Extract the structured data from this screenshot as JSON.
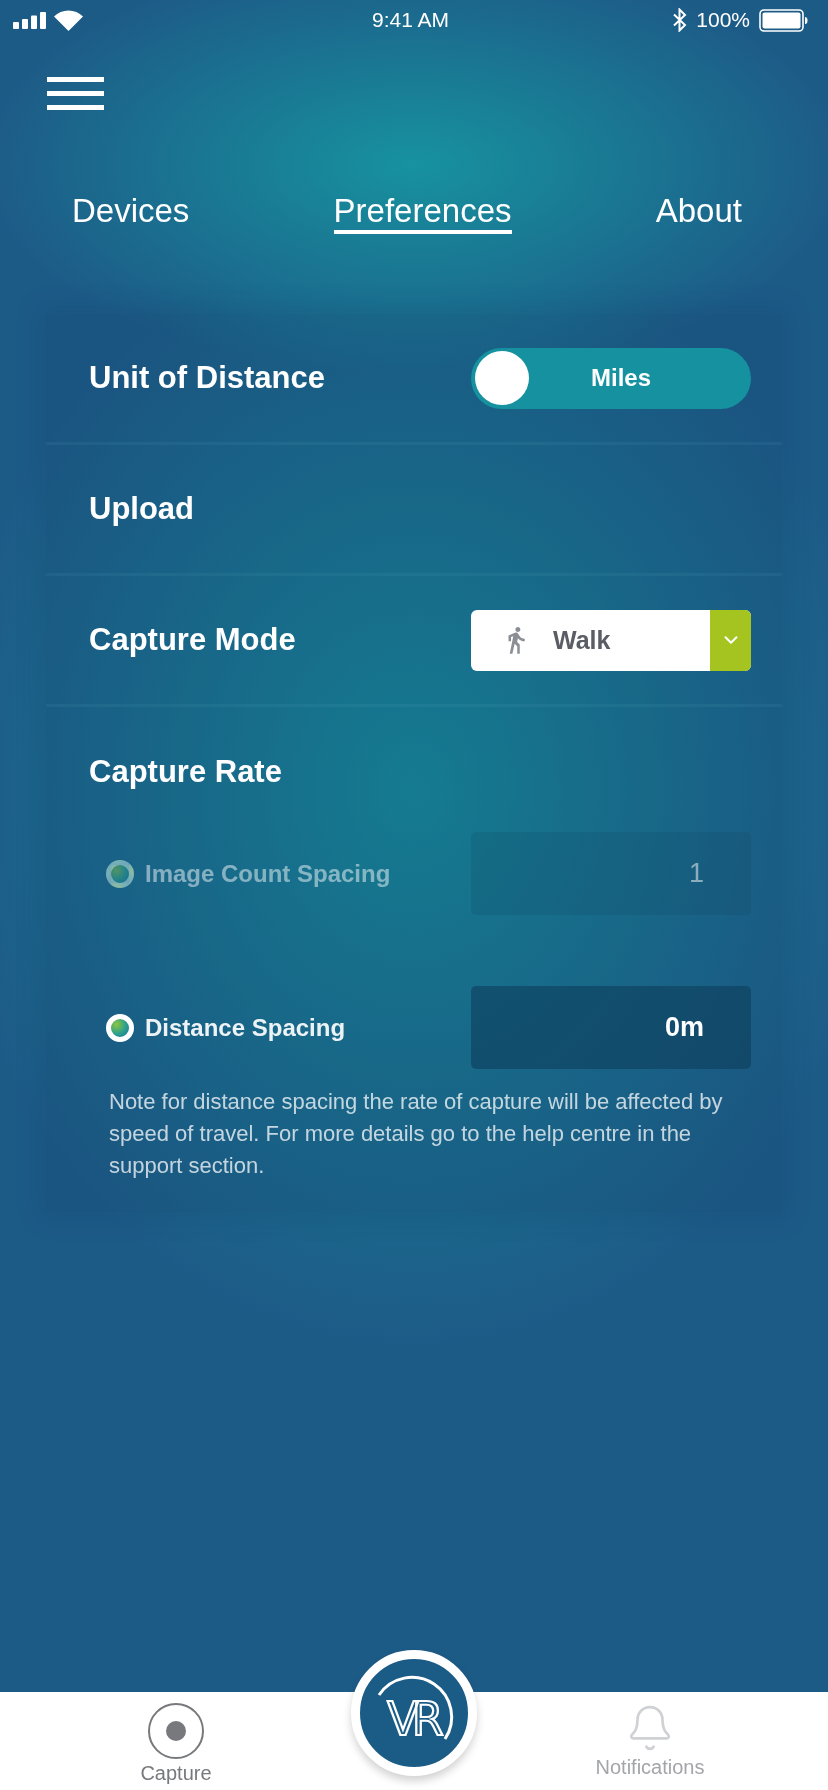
{
  "status_bar": {
    "time": "9:41 AM",
    "battery": "100%"
  },
  "tabs": [
    {
      "label": "Devices",
      "selected": false
    },
    {
      "label": "Preferences",
      "selected": true
    },
    {
      "label": "About",
      "selected": false
    }
  ],
  "settings": [
    {
      "kind": "toggle",
      "label": "Unit of Distance",
      "value": "Miles",
      "on": false
    },
    {
      "kind": "plain",
      "label": "Upload"
    },
    {
      "kind": "dropdown",
      "label": "Capture Mode",
      "value": "Walk"
    }
  ],
  "capture_rate": {
    "title": "Capture Rate",
    "options": [
      {
        "label": "Image Count Spacing",
        "value": "1",
        "selected": false
      },
      {
        "label": "Distance Spacing",
        "value": "0m",
        "selected": true
      }
    ],
    "note": "Note for distance spacing the rate of capture will be affected by speed of travel. For more details go to the help centre in the support section."
  },
  "bottom_nav": {
    "center_logo": "VR",
    "items": [
      {
        "kind": "capture",
        "label": "Capture",
        "selected": true
      },
      {
        "kind": "notifications",
        "label": "Notifications",
        "selected": false
      }
    ]
  }
}
